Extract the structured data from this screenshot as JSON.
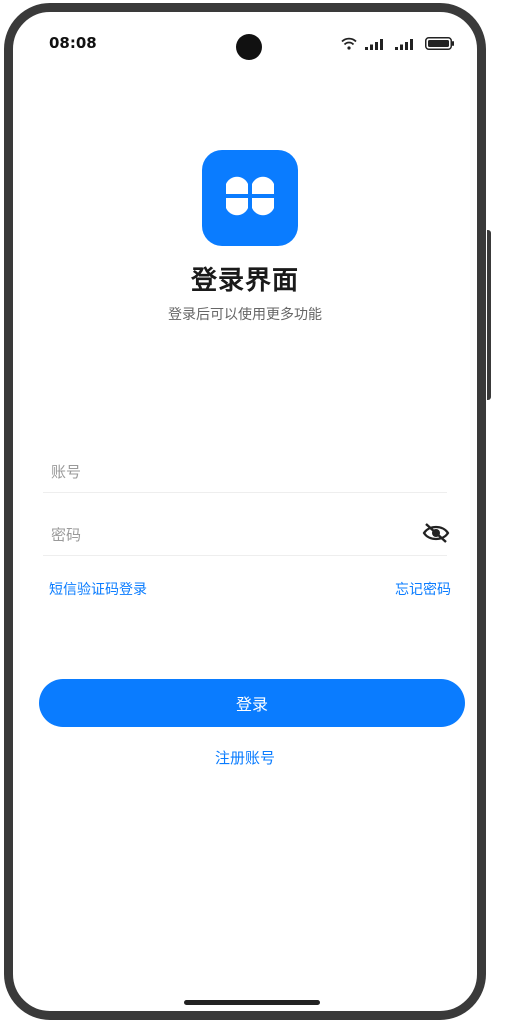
{
  "status_bar": {
    "time": "08:08",
    "icons": [
      "wifi-icon",
      "signal-icon",
      "signal-icon",
      "battery-icon"
    ]
  },
  "logo": {
    "icon": "four-leaf-clover-icon",
    "color": "#0a7cff"
  },
  "header": {
    "title": "登录界面",
    "subtitle": "登录后可以使用更多功能"
  },
  "form": {
    "account_placeholder": "账号",
    "password_placeholder": "密码",
    "password_visibility_icon": "eye-off-icon"
  },
  "links": {
    "sms_login": "短信验证码登录",
    "forgot_password": "忘记密码",
    "register": "注册账号"
  },
  "login_button": "登录",
  "colors": {
    "accent": "#0a7cff"
  }
}
